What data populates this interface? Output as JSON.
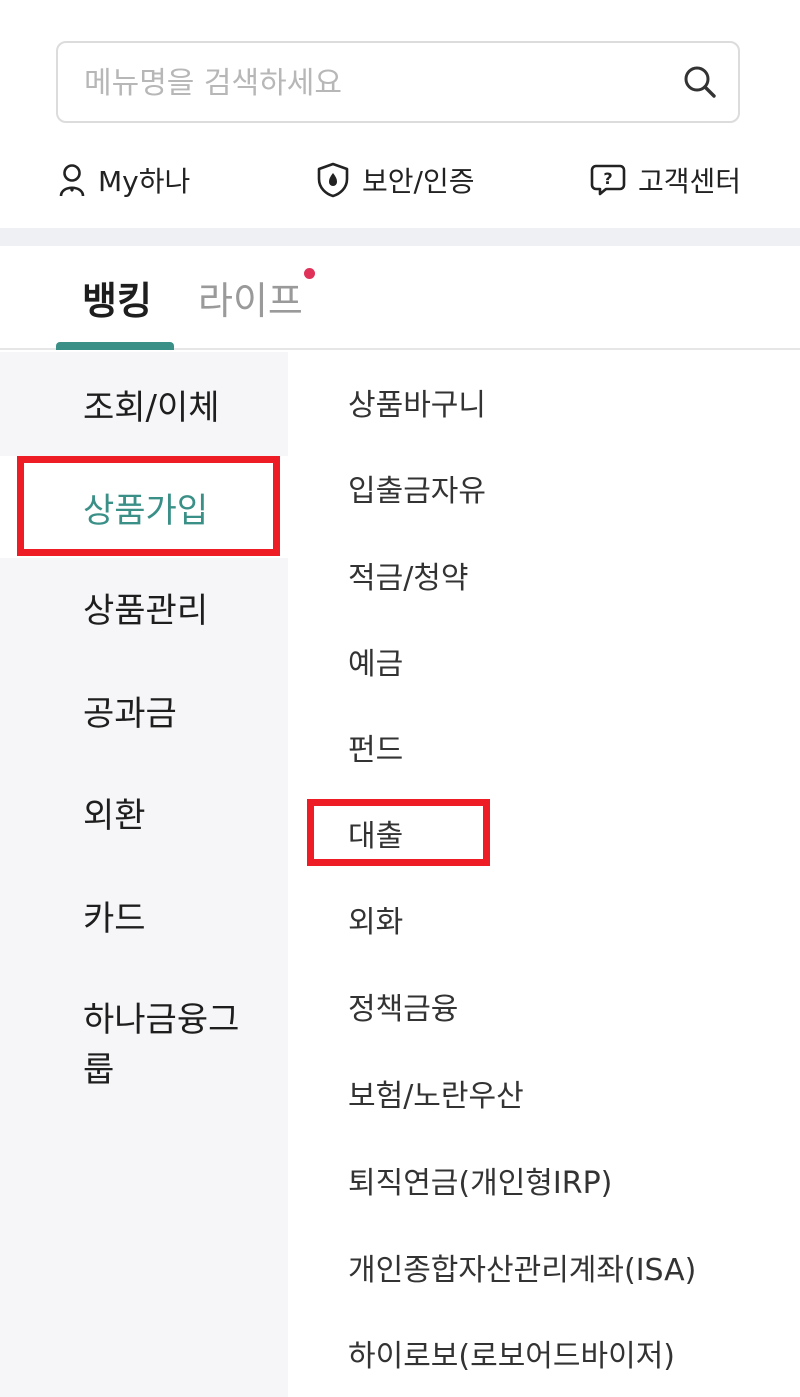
{
  "search": {
    "placeholder": "메뉴명을 검색하세요"
  },
  "quick_links": [
    {
      "label": "My하나",
      "icon": "user-icon"
    },
    {
      "label": "보안/인증",
      "icon": "shield-icon"
    },
    {
      "label": "고객센터",
      "icon": "help-chat-icon"
    }
  ],
  "tabs": [
    {
      "label": "뱅킹",
      "active": true
    },
    {
      "label": "라이프",
      "active": false,
      "badge": "new-dot"
    }
  ],
  "left_menu": [
    {
      "label": "조회/이체"
    },
    {
      "label": "상품가입",
      "active": true
    },
    {
      "label": "상품관리"
    },
    {
      "label": "공과금"
    },
    {
      "label": "외환"
    },
    {
      "label": "카드"
    },
    {
      "label": "하나금융그룹"
    }
  ],
  "right_menu": [
    {
      "label": "상품바구니"
    },
    {
      "label": "입출금자유"
    },
    {
      "label": "적금/청약"
    },
    {
      "label": "예금"
    },
    {
      "label": "펀드"
    },
    {
      "label": "대출"
    },
    {
      "label": "외화"
    },
    {
      "label": "정책금융"
    },
    {
      "label": "보험/노란우산"
    },
    {
      "label": "퇴직연금(개인형IRP)"
    },
    {
      "label": "개인종합자산관리계좌(ISA)"
    },
    {
      "label": "하이로보(로보어드바이저)"
    }
  ],
  "colors": {
    "accent": "#3a8f87",
    "highlight": "#ee1c25",
    "badge": "#e03159"
  }
}
